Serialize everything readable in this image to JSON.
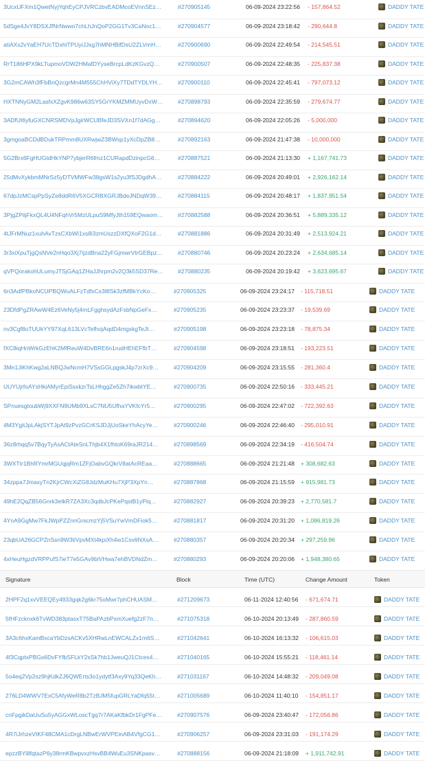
{
  "section1": [
    {
      "signature": "3UcxUFXm1QwetNyjYqhEyCPJVRCzbvEADMcoEVnnSEzqQaEq6...",
      "block": "#270905145",
      "time": "06-09-2024 23:22:56",
      "amount": "- 157,864.52",
      "token": "DADDY TATE"
    },
    {
      "signature": "5dSge4JvY8DSXJfNrNwwo7chLhJnQoP2GG1Tv3CaNoc14JuxrV...",
      "block": "#270904577",
      "time": "06-09-2024 23:18:42",
      "amount": "- 290,644.8",
      "token": "DADDY TATE"
    },
    {
      "signature": "atiAXx2vYaEH7UcTDxhiTPUyiJJxg7hMNHBifDsU2ZLVmHgdecch...",
      "block": "#270900690",
      "time": "06-09-2024 22:49:54",
      "amount": "- 214,545.51",
      "token": "DADDY TATE"
    },
    {
      "signature": "RrT186HPX9kLTupmoVDW2HMafDYyseBrcpLdKzKGvzQNPLWtL...",
      "block": "#270900507",
      "time": "06-09-2024 22:48:35",
      "amount": "- 225,837.38",
      "token": "DADDY TATE"
    },
    {
      "signature": "3G2mCAWh3fFbBnQzcgrMn4M555ChHViXy7TDdTYDLYHEKe3H...",
      "block": "#270900110",
      "time": "06-09-2024 22:45:41",
      "amount": "- 797,073.12",
      "token": "DADDY TATE"
    },
    {
      "signature": "HXTNNyGM2LasfxXZgvK986w63SY5GrYKMZMMUyvDxWsGoPK...",
      "block": "#270898793",
      "time": "06-09-2024 22:35:59",
      "amount": "- 279,674.77",
      "token": "DADDY TATE"
    },
    {
      "signature": "3ADfUt6yfuGXCNRSMDVpJgirWCUBfeJD3SVXn1f7dAGgGdFyT...",
      "block": "#270894620",
      "time": "06-09-2024 22:05:26",
      "amount": "- 5,000,000",
      "token": "DADDY TATE"
    },
    {
      "signature": "3gmgoaBCDdBDukTRPmm8UXRwjwZ3BWsp1yXcDpZB8R4ZsKL...",
      "block": "#270892163",
      "time": "06-09-2024 21:47:38",
      "amount": "- 10,000,000",
      "token": "DADDY TATE"
    },
    {
      "signature": "5G2Brx6FgHUGtdHkYNP7ybjerR6fmz1CURapdDzinpcG6Qca.Jnk...",
      "block": "#270887521",
      "time": "06-09-2024 21:13:30",
      "amount": "+ 1,167,741.73",
      "token": "DADDY TATE"
    },
    {
      "signature": "25dMvXykbmMNrSz5yDTVMWFw38gsW1s2yu3fSJDgdhAQ4VV...",
      "block": "#270884222",
      "time": "06-09-2024 20:49:01",
      "amount": "+ 2,926,162.14",
      "token": "DADDY TATE"
    },
    {
      "signature": "67dpJzMCspPpSyZe8ddR6V5XGCRBXGRJBdeJNDqW393snt5D...",
      "block": "#270884115",
      "time": "06-09-2024 20:48:17",
      "amount": "+ 1,837,951.54",
      "token": "DADDY TATE"
    },
    {
      "signature": "3PjgZPiijFkxQL4U4NFqhVr5MzULpuS9MfyJth159EQwaomkx82o...",
      "block": "#270882588",
      "time": "06-09-2024 20:36:51",
      "amount": "+ 5,889,335.12",
      "token": "DADDY TATE"
    },
    {
      "signature": "4tJFrMNuz1xuhAvTzsCXbWi1xs8i3zmUszzDXfQXoF2G1dDyAgM...",
      "block": "#270881886",
      "time": "06-09-2024 20:31:49",
      "amount": "+ 2,513,924.21",
      "token": "DADDY TATE"
    },
    {
      "signature": "3r3xiXpuTjgQsNVe2nHqo3Xj7ijzdBna22yFGjmwrVtrGEBpz17e2t...",
      "block": "#270880746",
      "time": "06-09-2024 20:23:24",
      "amount": "+ 2,634,685.14",
      "token": "DADDY TATE"
    },
    {
      "signature": "qVPQorakohULumyJTSjGAq1ZHaJJhrpm2v2Q3k5SD37RezquZB...",
      "block": "#270880235",
      "time": "06-09-2024 20:19:42",
      "amount": "+ 3,623,695.67",
      "token": "DADDY TATE"
    }
  ],
  "section2": [
    {
      "signature": "6n3AdfPBkoNCUPBQWuALFzTdfxCs38tSk3zfMBkYcKoXL2XmiV...",
      "block": "#270905325",
      "time": "06-09-2024 23:24:17",
      "amount": "- 115,718.51",
      "token": "DADDY TATE"
    },
    {
      "signature": "23DfdPgZRAwW4Ez6VeNy5j4mLFgghsydAzFsbNpGeFxEbWEn...",
      "block": "#270905235",
      "time": "06-09-2024 23:23:37",
      "amount": "- 19,539.69",
      "token": "DADDY TATE"
    },
    {
      "signature": "nv3Cgf8oTUUkYY97XqL613LVcTefhojAqdD4mgxkgTeJtmB4cwJ...",
      "block": "#270905198",
      "time": "06-09-2024 23:23:18",
      "amount": "- 78,875.34",
      "token": "DADDY TATE"
    },
    {
      "signature": "fXC8iqHnWrkGzEhK2MfReuW4DvBRE6n1rudHEhEFfbT9V2iCG7...",
      "block": "#270904598",
      "time": "06-09-2024 23:18:51",
      "amount": "- 193,223.51",
      "token": "DADDY TATE"
    },
    {
      "signature": "3Mn1JiKhKwg2aLNBQJwNcmH7VSsGGLpgskJ4p7zrXc9Q1JR7...",
      "block": "#270904209",
      "time": "06-09-2024 23:15:55",
      "amount": "- 281,360.4",
      "token": "DADDY TATE"
    },
    {
      "signature": "UUYUjrfoAYsHkiAMyrEpiSsxkzrTsLHhggZe5Zh7ikwbtYEhxFcWZt...",
      "block": "#270900735",
      "time": "06-09-2024 22:50:16",
      "amount": "- 333,445.21",
      "token": "DADDY TATE"
    },
    {
      "signature": "SPnuesgtoubWj9XXFN9UMb9XLsC7NU5UfhaYVKfcYr5UQ4MEh...",
      "block": "#270900295",
      "time": "06-09-2024 22:47:02",
      "amount": "- 722,392.63",
      "token": "DADDY TATE"
    },
    {
      "signature": "4M3YgitJpLAkjSYTJpAt9zPvzGCrKSJDJjUoSkeYhAcyYeTHHpu4t...",
      "block": "#270900246",
      "time": "06-09-2024 22:46:40",
      "amount": "- 295,010.91",
      "token": "DADDY TATE"
    },
    {
      "signature": "36z8rhqq5v7BqyTyAsACtAteSnLThjb4X1fhtoK69raJR214mRg5K...",
      "block": "#270898569",
      "time": "06-09-2024 22:34:19",
      "amount": "- 416,504.74",
      "token": "DADDY TATE"
    },
    {
      "signature": "3WXTtr1BhRYmrMGUqjqRm1ZFjOabvGQkrV8atAcREaaBagRcEZ...",
      "block": "#270888665",
      "time": "06-09-2024 21:21:48",
      "amount": "+ 308,682.63",
      "token": "DADDY TATE"
    },
    {
      "signature": "34zppa7JmaxyTn2KjrCWcXiZG8JdzMuKHu7XjP3XpYnWnwKBm...",
      "block": "#270887868",
      "time": "06-09-2024 21:15:59",
      "amount": "+ 915,981.73",
      "token": "DADDY TATE"
    },
    {
      "signature": "49hE2QqZB56Gnrk3etkR7ZA3Xc3qdbJcPKePqstB1yPiqWv3NK1...",
      "block": "#270882927",
      "time": "06-09-2024 20:39:23",
      "amount": "+ 2,770,581.7",
      "token": "DADDY TATE"
    },
    {
      "signature": "4YnA9GgMw7FkJWpPZZnnGrscmzYj5VSuYwVmDFiok52xmQQ...",
      "block": "#270881817",
      "time": "06-09-2024 20:31:20",
      "amount": "+ 1,086,819.26",
      "token": "DADDY TATE"
    },
    {
      "signature": "23qbUA26GCPZnSsn9W3tiVpvMXt4kpiXh4w1Csv6NXsAeT8eCFj...",
      "block": "#270880357",
      "time": "06-09-2024 20:20:34",
      "amount": "+ 297,259.96",
      "token": "DADDY TATE"
    },
    {
      "signature": "4xHeuHgzdVRPPufS7ieT7e5GAv9biVHwa7ehBVDNdZmEbJy8gJ...",
      "block": "#270880293",
      "time": "06-09-2024 20:20:06",
      "amount": "+ 1,948,380.65",
      "token": "DADDY TATE"
    }
  ],
  "section3": {
    "headers": {
      "signature": "Signature",
      "block": "Block",
      "time": "Time (UTC)",
      "change": "Change Amount",
      "token": "Token"
    },
    "rows": [
      {
        "signature": "2HPF2q1xvVEEQEy4933gqk2g6kr75oMwr7phCHUASMQDhrFHR...",
        "block": "#271209673",
        "time": "06-11-2024 12:40:56",
        "amount": "- 671,674.71",
        "token": "DADDY TATE"
      },
      {
        "signature": "5fHFzcknxk6TvWD383ptasxT75BaPAzbPxmXuefg2zF7nUxXhic7...",
        "block": "#271075318",
        "time": "06-10-2024 20:13:49",
        "amount": "- 287,860.59",
        "token": "DADDY TATE"
      },
      {
        "signature": "3A3c6hxKamBxcaYbDzsACKv5XHRwLnEWCALZx1m6SqHwhTf...",
        "block": "#271042641",
        "time": "06-10-2024 16:13:32",
        "amount": "- 106,615.03",
        "token": "DADDY TATE"
      },
      {
        "signature": "4f3CqptxPBGs6DvFYfbSFLkY2sSk7hb1JweuQJ1Ctces4P5p7Qe...",
        "block": "#271040165",
        "time": "06-10-2024 15:55:21",
        "amount": "- 118,461.14",
        "token": "DADDY TATE"
      },
      {
        "signature": "5o4eq2Vp2sz9hjKdkZJ6QWErts3o1ydytf3Axy9Yq33QeKhaQm1y...",
        "block": "#271031167",
        "time": "06-10-2024 14:48:32",
        "amount": "- 209,049.08",
        "token": "DADDY TATE"
      },
      {
        "signature": "276LD4WWV7ExC5AfyWeR8b2TzBJM5fupGRLYaDfq55tEyLCivF...",
        "block": "#271005689",
        "time": "06-10-2024 11:40:10",
        "amount": "- 154,851.17",
        "token": "DADDY TATE"
      },
      {
        "signature": "cnFpgikDaUuSu5yAGGxWLoscTgq7r7AKaKfbkDr1FgPFeUmUAR...",
        "block": "#270907576",
        "time": "06-09-2024 23:40:47",
        "amount": "- 172,056.86",
        "token": "DADDY TATE"
      },
      {
        "signature": "4R7iJrhzeVtKF48CMA1cDrgLNBwErWVPEinAB4VfgCG1Fmf411...",
        "block": "#270906257",
        "time": "06-09-2024 23:31:03",
        "amount": "- 191,174.29",
        "token": "DADDY TATE"
      },
      {
        "signature": "epzzBYi8fqtazP6y38rmKBwpvxzHsvBB4WuEu3SNKpasvqxkzr6d...",
        "block": "#270888156",
        "time": "06-09-2024 21:18:09",
        "amount": "+ 1,911,742.91",
        "token": "DADDY TATE"
      }
    ]
  },
  "token_icon": "token-avatar-icon",
  "colors": {
    "link": "#4a8fc7",
    "negative": "#d9534f",
    "positive": "#3aa56a"
  }
}
